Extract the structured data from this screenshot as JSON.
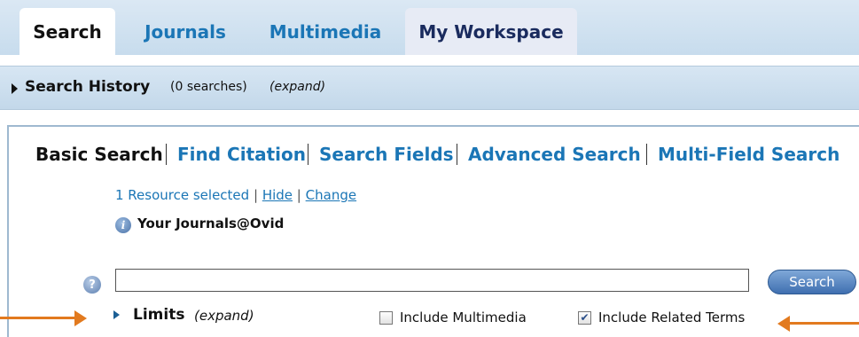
{
  "tabs": [
    {
      "label": "Search",
      "active": true
    },
    {
      "label": "Journals",
      "active": false
    },
    {
      "label": "Multimedia",
      "active": false
    },
    {
      "label": "My Workspace",
      "active": false
    }
  ],
  "history": {
    "title": "Search History",
    "count": "(0 searches)",
    "expand": "(expand)"
  },
  "modes": [
    {
      "label": "Basic Search",
      "active": true
    },
    {
      "label": "Find Citation",
      "active": false
    },
    {
      "label": "Search Fields",
      "active": false
    },
    {
      "label": "Advanced Search",
      "active": false
    },
    {
      "label": "Multi-Field Search",
      "active": false
    }
  ],
  "resource": {
    "selected": "1 Resource selected",
    "sep": "|",
    "hide": "Hide",
    "change": "Change"
  },
  "journals_label": "Your Journals@Ovid",
  "search": {
    "value": "",
    "button": "Search"
  },
  "limits": {
    "label": "Limits",
    "expand": "(expand)"
  },
  "options": [
    {
      "label": "Include Multimedia",
      "checked": false
    },
    {
      "label": "Include Related Terms",
      "checked": true
    }
  ],
  "icons": {
    "info": "info-icon",
    "help": "help-icon"
  },
  "colors": {
    "link": "#1b76b6",
    "accent_arrow": "#e27a1f",
    "tab_bar": "#c7dced"
  }
}
